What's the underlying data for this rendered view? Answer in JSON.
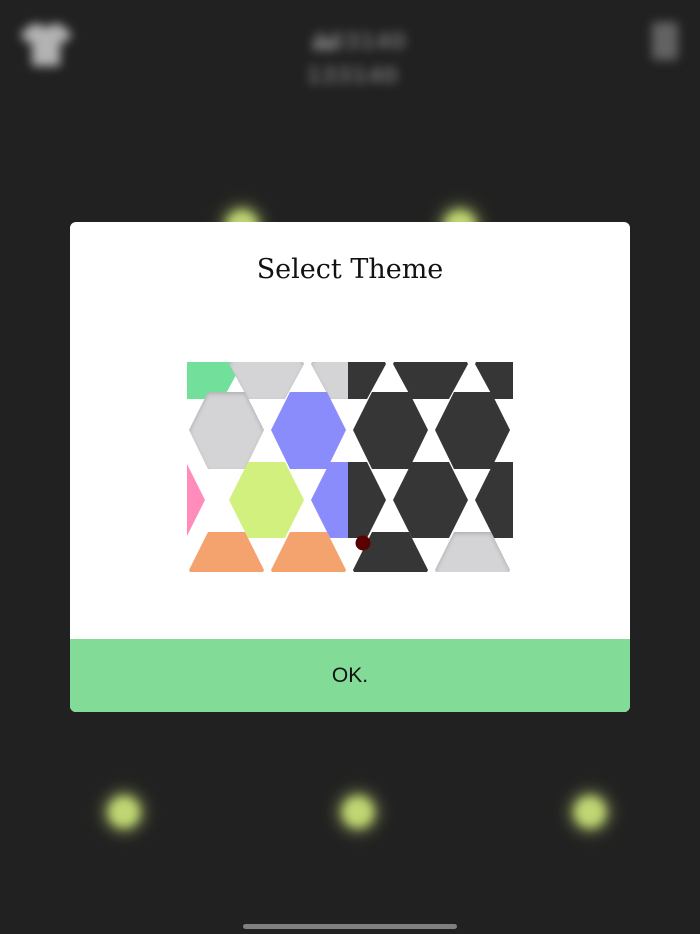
{
  "background": {
    "score_primary": "133140",
    "score_secondary": "133140"
  },
  "dialog": {
    "title": "Select Theme",
    "ok_label": "OK.",
    "accent_color": "#82dc98"
  },
  "themes": {
    "light": {
      "name": "light-theme",
      "colors": [
        "#72df9a",
        "#d4d4d6",
        "#8a8cfc",
        "#ff8cba",
        "#d2f07e",
        "#f4a36f"
      ]
    },
    "dark": {
      "name": "dark-theme",
      "colors": [
        "#363636",
        "#d4d4d6"
      ]
    }
  },
  "icons": {
    "top_left": "shirt-icon",
    "top_right": "menu-icon",
    "score": "crown-icon",
    "pointer": "theme-split-handle"
  }
}
